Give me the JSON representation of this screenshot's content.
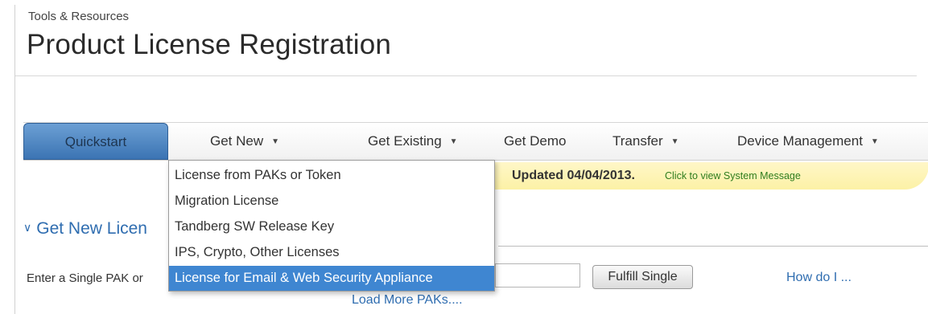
{
  "header": {
    "breadcrumb": "Tools & Resources",
    "title": "Product License Registration"
  },
  "nav": {
    "items": [
      {
        "label": "Quickstart",
        "has_dropdown": false,
        "active": true
      },
      {
        "label": "Get New",
        "has_dropdown": true
      },
      {
        "label": "Get Existing",
        "has_dropdown": true
      },
      {
        "label": "Get Demo",
        "has_dropdown": false
      },
      {
        "label": "Transfer",
        "has_dropdown": true
      },
      {
        "label": "Device Management",
        "has_dropdown": true
      }
    ],
    "caret": "▼"
  },
  "dropdown": {
    "items": [
      {
        "label": "License from PAKs or Token"
      },
      {
        "label": "Migration License"
      },
      {
        "label": "Tandberg SW Release Key"
      },
      {
        "label": "IPS, Crypto, Other Licenses"
      },
      {
        "label": "License for Email & Web Security Appliance",
        "selected": true
      }
    ]
  },
  "notice": {
    "updated": "Updated 04/04/2013.",
    "link": "Click to view System Message"
  },
  "section": {
    "chevron": "∨",
    "heading": "Get New Licen"
  },
  "form": {
    "label": "Enter a Single PAK or",
    "pak_value": "",
    "fulfill_label": "Fulfill Single",
    "howdoi": "How do I ...",
    "load_more": "Load More PAKs...."
  },
  "colors": {
    "accent": "#2f6db0",
    "quickstart_tab": "#3b74b3",
    "menu_selected": "#3f86d1",
    "notice_bg": "#fcf1a6",
    "notice_link": "#2e7d1e"
  }
}
